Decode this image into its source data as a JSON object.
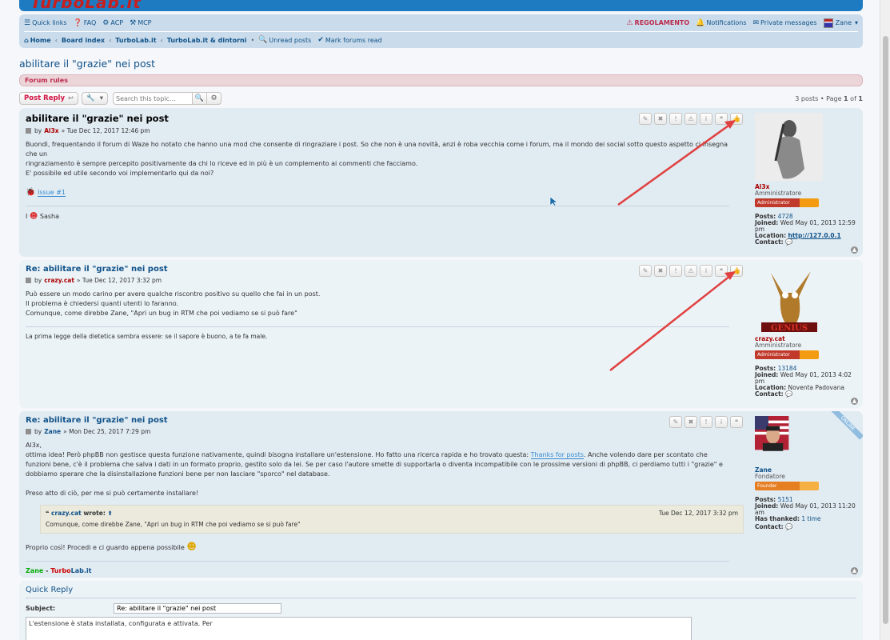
{
  "header": {
    "logo": "TurboLab.it"
  },
  "nav": {
    "quick_links": "Quick links",
    "faq": "FAQ",
    "acp": "ACP",
    "mcp": "MCP",
    "regolamento": "REGOLAMENTO",
    "notifications": "Notifications",
    "private_messages": "Private messages",
    "user": "Zane",
    "breadcrumbs": [
      "Home",
      "Board index",
      "TurboLab.it",
      "TurboLab.it & dintorni"
    ],
    "unread_posts": "Unread posts",
    "mark_forums_read": "Mark forums read"
  },
  "topic": {
    "title": "abilitare il \"grazie\" nei post",
    "forum_rules": "Forum rules",
    "post_reply": "Post Reply",
    "search_placeholder": "Search this topic…",
    "posts_count": "3 posts • Page ",
    "page_current": "1",
    "page_of": " of ",
    "page_total": "1"
  },
  "posts": [
    {
      "title": "abilitare il \"grazie\" nei post",
      "by": "by",
      "author": "Al3x",
      "date": "» Tue Dec 12, 2017 12:46 pm",
      "body": [
        "Buondì, frequentando il forum di Waze ho notato che hanno una mod che consente di ringraziare i post. So che non è una novità, anzi è roba vecchia come i forum, ma il mondo dei social sotto questo aspetto ci insegna che un",
        "ringraziamento è sempre percepito positivamente da chi lo riceve ed in più è un complemento ai commenti che facciamo.",
        "E' possibile ed utile secondo voi implementarlo qui da noi?"
      ],
      "issue": "Issue #1",
      "signature": "Sasha",
      "profile": {
        "name": "Al3x",
        "rank": "Amministratore",
        "rank_badge": "Administrator",
        "posts_label": "Posts:",
        "posts": "4728",
        "joined_label": "Joined:",
        "joined": "Wed May 01, 2013 12:59 pm",
        "location_label": "Location:",
        "location": "http://127.0.0.1",
        "contact_label": "Contact:"
      }
    },
    {
      "title": "Re: abilitare il \"grazie\" nei post",
      "by": "by",
      "author": "crazy.cat",
      "date": "» Tue Dec 12, 2017 3:32 pm",
      "body": [
        "Può essere un modo carino per avere qualche riscontro positivo su quello che fai in un post.",
        "Il problema è chiedersi quanti utenti lo faranno.",
        "Comunque, come direbbe Zane, \"Apri un bug in RTM che poi vediamo se si può fare\""
      ],
      "signature": "La prima legge della dietetica sembra essere: se il sapore è buono, a te fa male.",
      "profile": {
        "name": "crazy.cat",
        "rank": "Amministratore",
        "rank_badge": "Administrator",
        "posts_label": "Posts:",
        "posts": "13184",
        "joined_label": "Joined:",
        "joined": "Wed May 01, 2013 4:02 pm",
        "location_label": "Location:",
        "location": "Noventa Padovana",
        "contact_label": "Contact:",
        "avatar_text": "GENIUS"
      }
    },
    {
      "title": "Re: abilitare il \"grazie\" nei post",
      "by": "by",
      "author": "Zane",
      "date": "» Mon Dec 25, 2017 7:29 pm",
      "greeting": "Al3x,",
      "body_pre": "ottima idea! Però phpBB non gestisce questa funzione nativamente, quindi bisogna installare un'estensione. Ho fatto una ricerca rapida e ho trovato questa: ",
      "body_link": "Thanks for posts",
      "body_post": ". Anche volendo dare per scontato che funzioni bene, c'è il problema che salva i dati in un formato proprio, gestito solo da lei. Se per caso l'autore smette di supportarla o diventa incompatibile con le prossime versioni di phpBB, ci perdiamo tutti i \"grazie\" e dobbiamo sperare che la disinstallazione funzioni bene per non lasciare \"sporco\" nel database.",
      "body2": "Preso atto di ciò, per me si può certamente installare!",
      "quote_author": "crazy.cat",
      "quote_wrote": "wrote:",
      "quote_date": "Tue Dec 12, 2017 3:32 pm",
      "quote_text": "Comunque, come direbbe Zane, \"Apri un bug in RTM che poi vediamo se si può fare\"",
      "body3": "Proprio così! Procedi e ci guardo appena possibile",
      "sig_name": "Zane",
      "sig_sep": " - ",
      "sig_site_turbo": "Turbo",
      "sig_site_lab": "Lab.it",
      "online": "ONLINE",
      "profile": {
        "name": "Zane",
        "rank": "Fondatore",
        "rank_badge": "Founder",
        "posts_label": "Posts:",
        "posts": "5151",
        "joined_label": "Joined:",
        "joined": "Wed May 01, 2013 11:20 am",
        "thanked_label": "Has thanked:",
        "thanked": "1 time",
        "contact_label": "Contact:"
      }
    }
  ],
  "quick_reply": {
    "title": "Quick Reply",
    "subject_label": "Subject:",
    "subject_value": "Re: abilitare il \"grazie\" nei post",
    "message": "L'estensione è stata installata, configurata e attivata. Per"
  },
  "colors": {
    "accent": "#105289",
    "admin_red": "#aa0000",
    "founder_green": "#00aa00",
    "annotation_arrow": "#e04040"
  }
}
